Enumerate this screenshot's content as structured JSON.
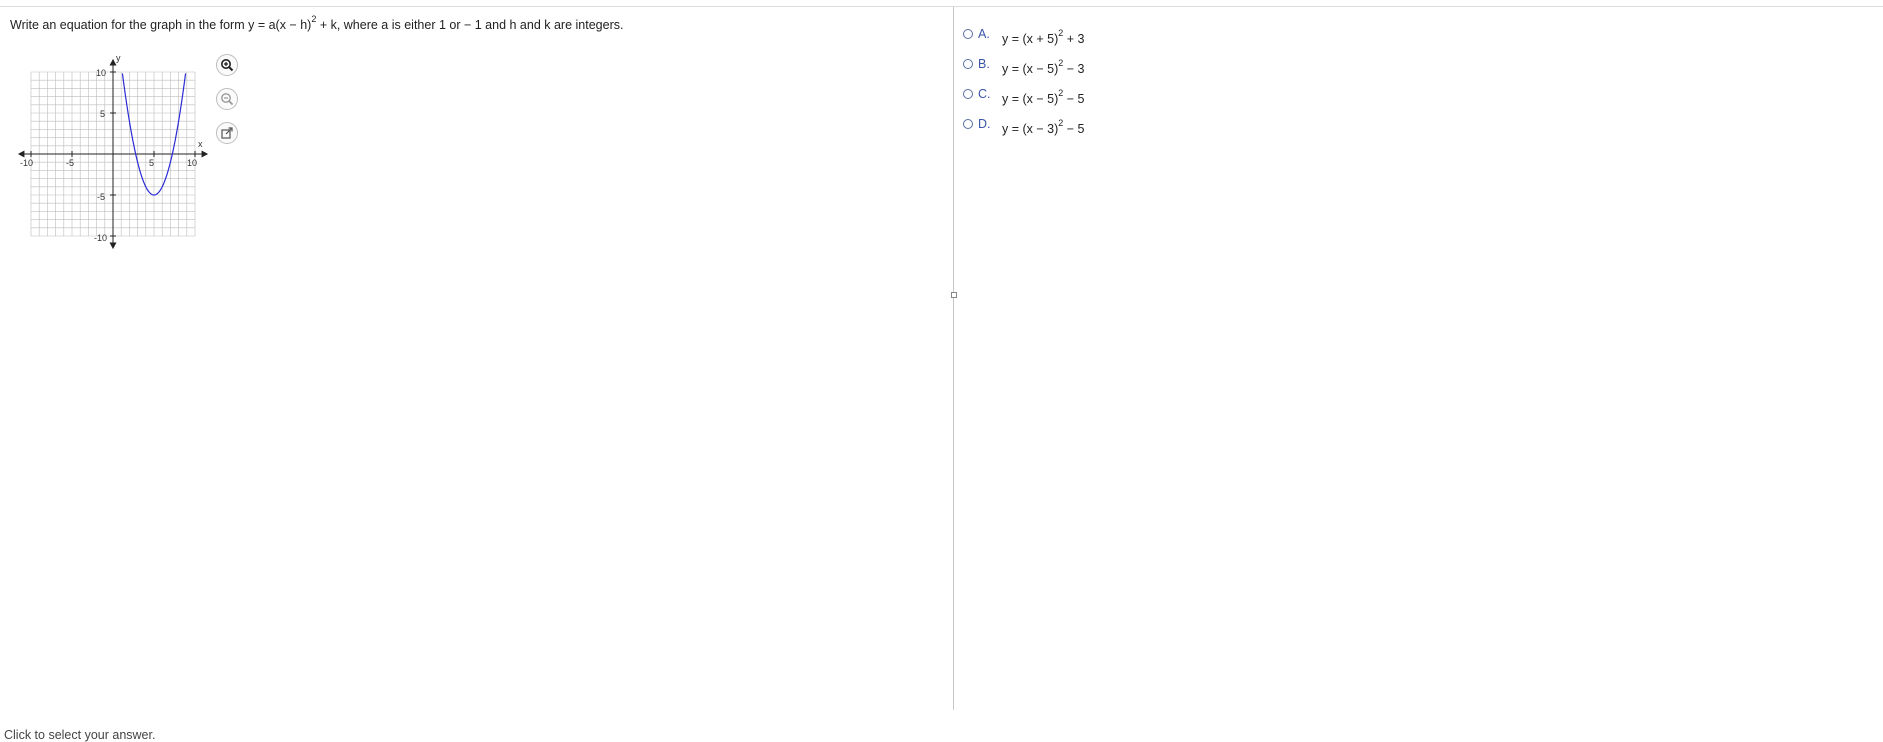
{
  "question": {
    "prefix": "Write an equation for the graph in the form y = a(x − h)",
    "exponent": "2",
    "suffix": " + k, where a is either 1 or  − 1 and h and k are integers."
  },
  "graph": {
    "y_axis_label": "y",
    "x_axis_label": "x",
    "tick_labels": {
      "x_neg10": "-10",
      "x_neg5": "-5",
      "x_5": "5",
      "x_10": "10",
      "y_10": "10",
      "y_5": "5",
      "y_neg5": "-5",
      "y_neg10": "-10"
    },
    "curve_color": "#2b2bd6"
  },
  "tools": [
    {
      "name": "zoom-in-icon"
    },
    {
      "name": "zoom-out-icon"
    },
    {
      "name": "open-external-icon"
    }
  ],
  "choices": [
    {
      "letter": "A.",
      "lhs": "y = (x + 5)",
      "exp": "2",
      "rhs": " + 3"
    },
    {
      "letter": "B.",
      "lhs": "y = (x − 5)",
      "exp": "2",
      "rhs": " − 3"
    },
    {
      "letter": "C.",
      "lhs": "y = (x − 5)",
      "exp": "2",
      "rhs": " − 5"
    },
    {
      "letter": "D.",
      "lhs": "y = (x − 3)",
      "exp": "2",
      "rhs": " − 5"
    }
  ],
  "footer": "Click to select your answer."
}
